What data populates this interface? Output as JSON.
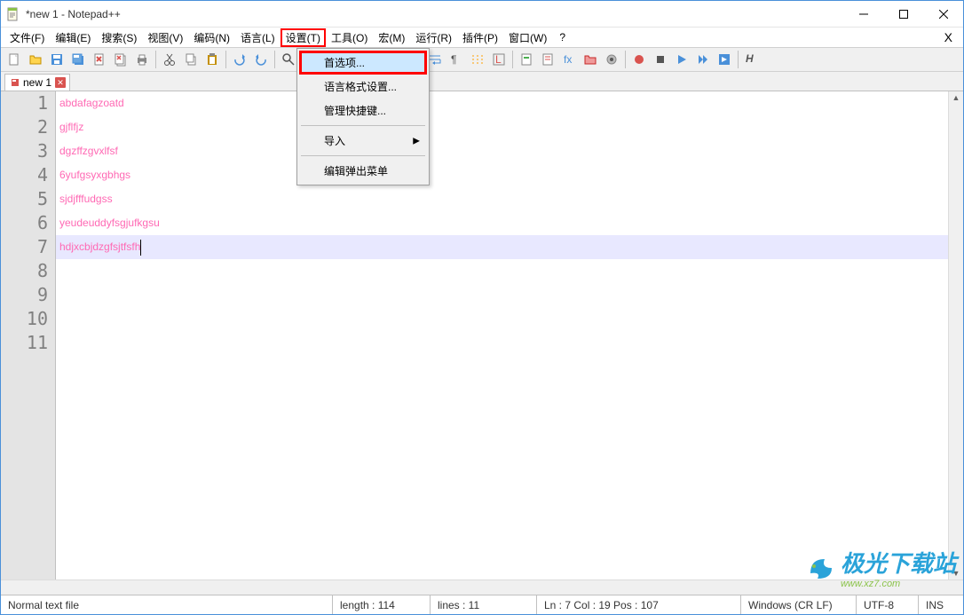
{
  "title": "*new 1 - Notepad++",
  "menubar": {
    "items": [
      {
        "label": "文件(F)"
      },
      {
        "label": "编辑(E)"
      },
      {
        "label": "搜索(S)"
      },
      {
        "label": "视图(V)"
      },
      {
        "label": "编码(N)"
      },
      {
        "label": "语言(L)"
      },
      {
        "label": "设置(T)"
      },
      {
        "label": "工具(O)"
      },
      {
        "label": "宏(M)"
      },
      {
        "label": "运行(R)"
      },
      {
        "label": "插件(P)"
      },
      {
        "label": "窗口(W)"
      }
    ],
    "help": "?",
    "close_x": "X"
  },
  "dropdown": {
    "items": [
      {
        "label": "首选项...",
        "highlighted": true
      },
      {
        "label": "语言格式设置..."
      },
      {
        "label": "管理快捷键..."
      },
      {
        "sep": true
      },
      {
        "label": "导入",
        "submenu": true
      },
      {
        "sep": true
      },
      {
        "label": "编辑弹出菜单"
      }
    ]
  },
  "tab": {
    "label": "new 1"
  },
  "lines": [
    "abdafagzoatd",
    "gjflfjz",
    "dgzffzgvxlfsf",
    "6yufgsyxgbhgs",
    "sjdjfffudgss",
    "yeudeuddyfsgjufkgsu",
    "hdjxcbjdzgfsjtfsfh"
  ],
  "gutter_max": 11,
  "current_line": 7,
  "status": {
    "filetype": "Normal text file",
    "length": "length : 114",
    "lines": "lines : 11",
    "pos": "Ln : 7    Col : 19    Pos : 107",
    "eol": "Windows (CR LF)",
    "enc": "UTF-8",
    "ins": "INS"
  },
  "watermark": {
    "brand": "极光下载站",
    "url": "www.xz7.com"
  }
}
